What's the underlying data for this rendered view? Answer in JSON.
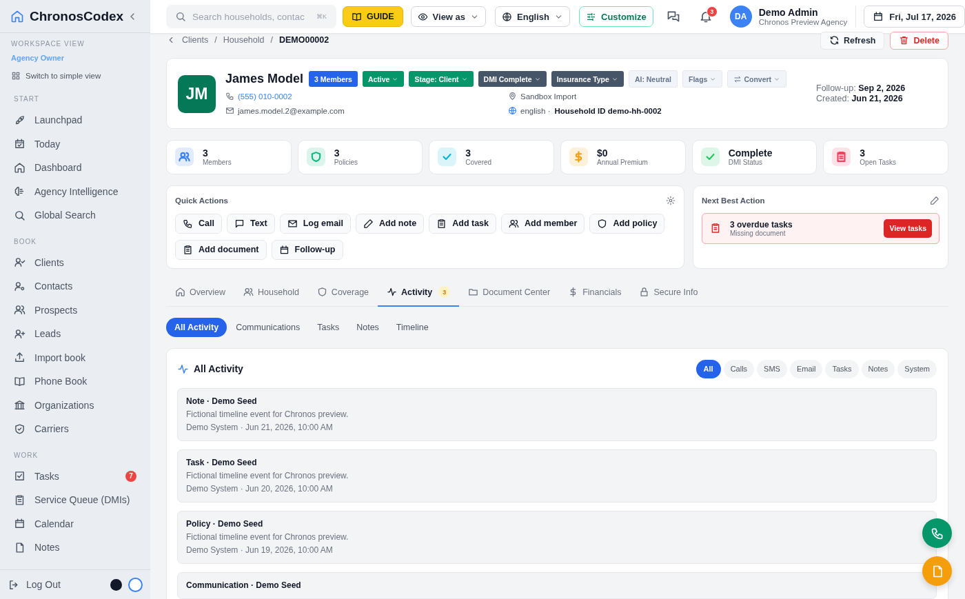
{
  "sidebar": {
    "brand": "ChronosCodex",
    "workspace": {
      "label": "WORKSPACE VIEW",
      "role": "Agency Owner",
      "switch_link": "Switch to simple view"
    },
    "sections": [
      {
        "title": "START",
        "items": [
          {
            "label": "Launchpad"
          },
          {
            "label": "Today"
          },
          {
            "label": "Dashboard"
          },
          {
            "label": "Agency Intelligence"
          },
          {
            "label": "Global Search"
          }
        ]
      },
      {
        "title": "BOOK",
        "items": [
          {
            "label": "Clients"
          },
          {
            "label": "Contacts"
          },
          {
            "label": "Prospects"
          },
          {
            "label": "Leads"
          },
          {
            "label": "Import book"
          },
          {
            "label": "Phone Book"
          },
          {
            "label": "Organizations"
          },
          {
            "label": "Carriers"
          }
        ]
      },
      {
        "title": "WORK",
        "items": [
          {
            "label": "Tasks",
            "badge": "7"
          },
          {
            "label": "Service Queue (DMIs)"
          },
          {
            "label": "Calendar"
          },
          {
            "label": "Notes"
          }
        ]
      }
    ],
    "logout": "Log Out",
    "theme_options": [
      {
        "color": "#111827",
        "selected": false
      },
      {
        "color": "#ffffff",
        "selected": true
      }
    ]
  },
  "header": {
    "search": {
      "placeholder": "Search households, contac",
      "shortcut": "⌘K"
    },
    "guide": "GUIDE",
    "view_as": "View as",
    "language": "English",
    "customize": "Customize",
    "notifications": "3",
    "user": {
      "initials": "DA",
      "name": "Demo Admin",
      "org": "Chronos Preview Agency"
    },
    "date": "Fri, Jul 17, 2026"
  },
  "breadcrumb": {
    "separator": "/",
    "items": [
      "Clients",
      "Household",
      "DEMO00002"
    ]
  },
  "page_actions": [
    {
      "label": "Refresh",
      "kind": "default"
    },
    {
      "label": "Delete",
      "kind": "danger"
    }
  ],
  "household": {
    "initials": "JM",
    "name": "James Model",
    "badges": [
      {
        "label": "3 Members",
        "kind": "count",
        "dropdown": false
      },
      {
        "label": "Active",
        "kind": "success",
        "dropdown": true
      },
      {
        "label": "Stage: Client",
        "kind": "success",
        "dropdown": true
      },
      {
        "label": "DMI Complete",
        "kind": "dark",
        "dropdown": true
      },
      {
        "label": "Insurance Type",
        "kind": "dark",
        "dropdown": true
      },
      {
        "label": "AI: Neutral",
        "kind": "muted",
        "dropdown": false
      },
      {
        "label": "Flags",
        "kind": "muted",
        "dropdown": true
      },
      {
        "label": "Convert",
        "kind": "convert",
        "dropdown": true
      }
    ],
    "phone": "(555) 010-0002",
    "email": "james.model.2@example.com",
    "source": "Sandbox Import",
    "language": "english ·",
    "household_id": "Household ID demo-hh-0002",
    "follow_up": {
      "label": "Follow-up:",
      "value": "Sep 2, 2026"
    },
    "created": {
      "label": "Created:",
      "value": "Jun 21, 2026"
    }
  },
  "stats": [
    {
      "value": "3",
      "label": "Members",
      "color": "#3b82f6"
    },
    {
      "value": "3",
      "label": "Policies",
      "color": "#10b981"
    },
    {
      "value": "3",
      "label": "Covered",
      "color": "#06b6d4"
    },
    {
      "value": "$0",
      "label": "Annual Premium",
      "color": "#f59e0b"
    },
    {
      "value": "Complete",
      "label": "DMI Status",
      "color": "#22c55e"
    },
    {
      "value": "3",
      "label": "Open Tasks",
      "color": "#f43f5e"
    }
  ],
  "quick_actions": {
    "title": "Quick Actions",
    "buttons": [
      "Call",
      "Text",
      "Log email",
      "Add note",
      "Add task",
      "Add member",
      "Add policy",
      "Add document",
      "Follow-up"
    ]
  },
  "next_best_action": {
    "title": "Next Best Action",
    "alert": {
      "title": "3 overdue tasks",
      "detail": "Missing document",
      "button": "View tasks"
    }
  },
  "tabs": [
    {
      "label": "Overview",
      "selected": false
    },
    {
      "label": "Household",
      "selected": false
    },
    {
      "label": "Coverage",
      "selected": false
    },
    {
      "label": "Activity",
      "selected": true,
      "badge": "3"
    },
    {
      "label": "Document Center",
      "selected": false
    },
    {
      "label": "Financials",
      "selected": false
    },
    {
      "label": "Secure Info",
      "selected": false
    }
  ],
  "subtabs": [
    {
      "label": "All Activity",
      "selected": true
    },
    {
      "label": "Communications",
      "selected": false
    },
    {
      "label": "Tasks",
      "selected": false
    },
    {
      "label": "Notes",
      "selected": false
    },
    {
      "label": "Timeline",
      "selected": false
    }
  ],
  "activity": {
    "title": "All Activity",
    "filters": [
      {
        "label": "All",
        "selected": true
      },
      {
        "label": "Calls",
        "selected": false
      },
      {
        "label": "SMS",
        "selected": false
      },
      {
        "label": "Email",
        "selected": false
      },
      {
        "label": "Tasks",
        "selected": false
      },
      {
        "label": "Notes",
        "selected": false
      },
      {
        "label": "System",
        "selected": false
      }
    ],
    "entries": [
      {
        "title": "Note · Demo Seed",
        "description": "Fictional timeline event for Chronos preview.",
        "meta": "Demo System · Jun 21, 2026, 10:00 AM"
      },
      {
        "title": "Task · Demo Seed",
        "description": "Fictional timeline event for Chronos preview.",
        "meta": "Demo System · Jun 20, 2026, 10:00 AM"
      },
      {
        "title": "Policy · Demo Seed",
        "description": "Fictional timeline event for Chronos preview.",
        "meta": "Demo System · Jun 19, 2026, 10:00 AM"
      },
      {
        "title": "Communication · Demo Seed"
      }
    ]
  }
}
